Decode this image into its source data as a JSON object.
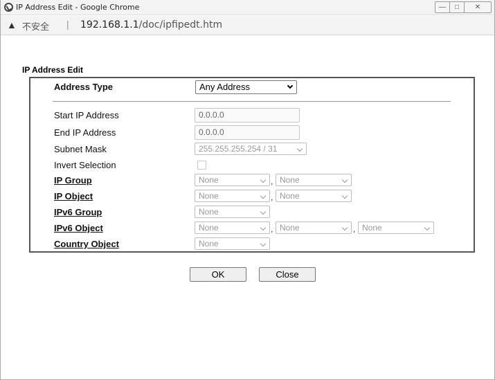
{
  "window": {
    "title": "IP Address Edit - Google Chrome",
    "insecure_label": "不安全",
    "separator": "|",
    "url_host": "192.168.1.1",
    "url_path": "/doc/ipfipedt.htm"
  },
  "form": {
    "title": "IP Address Edit",
    "address_type_label": "Address Type",
    "address_type_value": "Any Address",
    "start_ip_label": "Start IP Address",
    "start_ip_value": "0.0.0.0",
    "end_ip_label": "End IP Address",
    "end_ip_value": "0.0.0.0",
    "subnet_mask_label": "Subnet Mask",
    "subnet_mask_value": "255.255.255.254 / 31",
    "invert_label": "Invert Selection",
    "ip_group_label": "IP Group",
    "ip_group_values": [
      "None",
      "None"
    ],
    "ip_object_label": "IP Object",
    "ip_object_values": [
      "None",
      "None"
    ],
    "ipv6_group_label": "IPv6 Group",
    "ipv6_group_values": [
      "None"
    ],
    "ipv6_object_label": "IPv6 Object",
    "ipv6_object_values": [
      "None",
      "None",
      "None"
    ],
    "country_object_label": "Country Object",
    "country_object_values": [
      "None"
    ],
    "comma": ","
  },
  "buttons": {
    "ok": "OK",
    "close": "Close"
  }
}
